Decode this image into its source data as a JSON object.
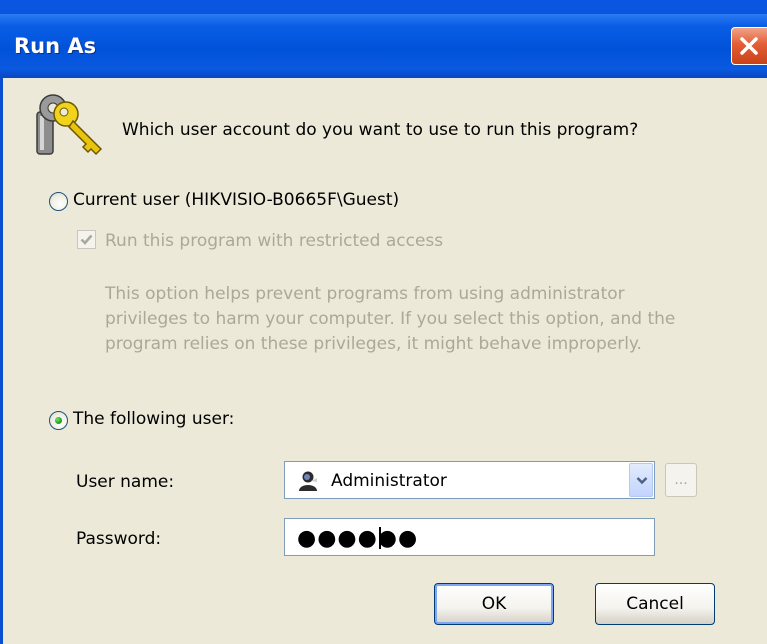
{
  "window": {
    "title": "Run As",
    "close_icon": "close-icon"
  },
  "dialog": {
    "icon": "keys-icon",
    "question": "Which user account do you want to use to run this program?",
    "current_user": {
      "label": "Current user (HIKVISIO-B0665F\\Guest)",
      "selected": false
    },
    "restricted": {
      "label": "Run this program with restricted access",
      "checked": true,
      "enabled": false
    },
    "help_text": "This option helps prevent programs from using administrator\nprivileges to harm your computer.  If you select this option, and the\nprogram relies on these privileges, it might behave improperly.",
    "following_user": {
      "label": "The following user:",
      "selected": true
    },
    "username": {
      "label": "User name:",
      "value": "Administrator",
      "icon": "user-icon"
    },
    "browse_label": "...",
    "password": {
      "label": "Password:",
      "value": "●●●●●●"
    },
    "ok_label": "OK",
    "cancel_label": "Cancel"
  },
  "colors": {
    "titlebar": "#0052d9",
    "client": "#ece9d8",
    "close": "#e35d35",
    "disabled_text": "#aca899"
  }
}
